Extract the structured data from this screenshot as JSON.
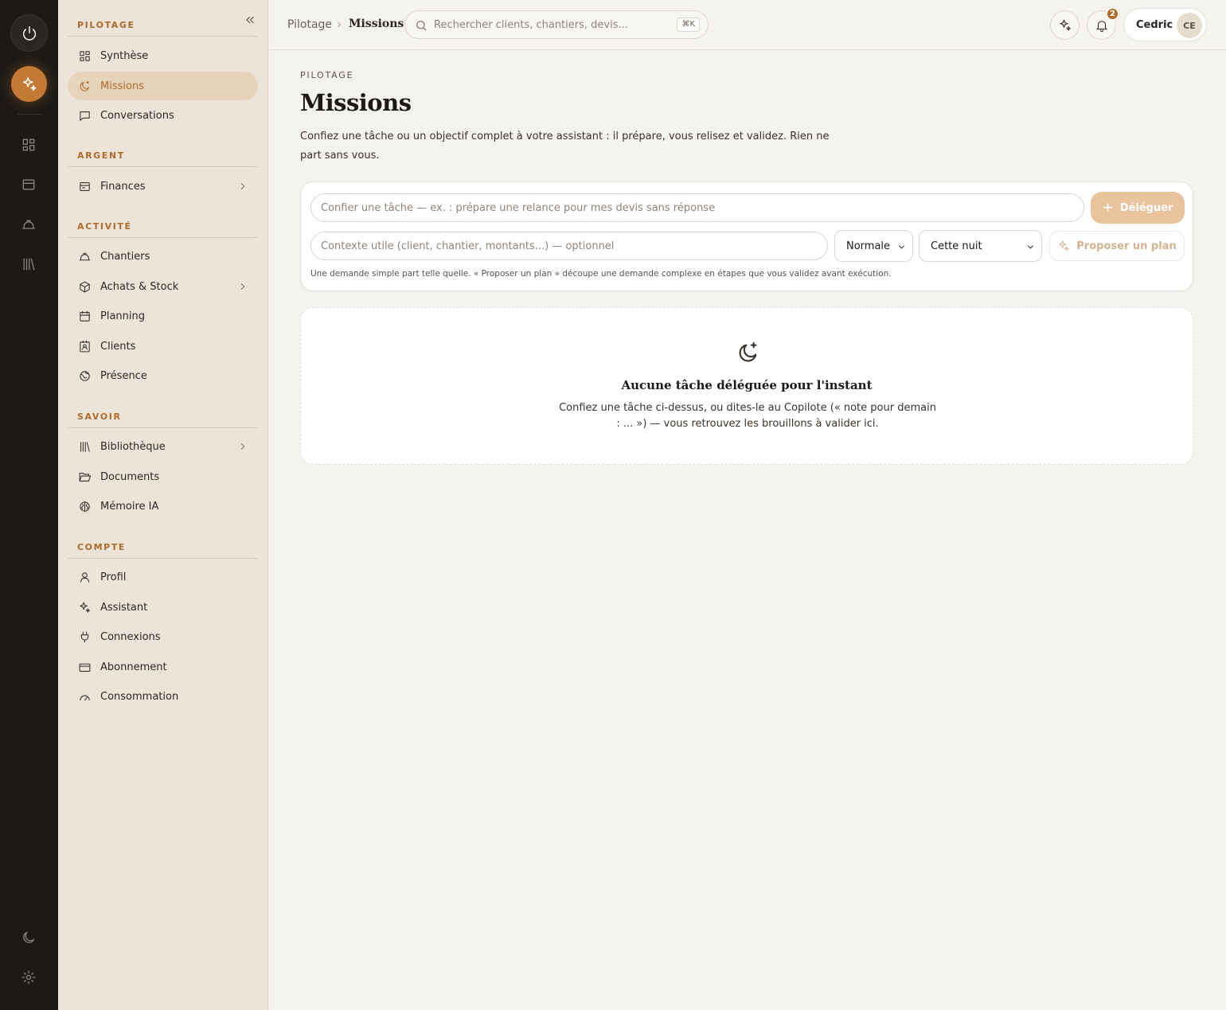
{
  "sidebar": {
    "sections": [
      {
        "title": "PILOTAGE",
        "items": [
          {
            "label": "Synthèse"
          },
          {
            "label": "Missions"
          },
          {
            "label": "Conversations"
          }
        ]
      },
      {
        "title": "ARGENT",
        "items": [
          {
            "label": "Finances"
          }
        ]
      },
      {
        "title": "ACTIVITÉ",
        "items": [
          {
            "label": "Chantiers"
          },
          {
            "label": "Achats & Stock"
          },
          {
            "label": "Planning"
          },
          {
            "label": "Clients"
          },
          {
            "label": "Présence"
          }
        ]
      },
      {
        "title": "SAVOIR",
        "items": [
          {
            "label": "Bibliothèque"
          },
          {
            "label": "Documents"
          },
          {
            "label": "Mémoire IA"
          }
        ]
      },
      {
        "title": "COMPTE",
        "items": [
          {
            "label": "Profil"
          },
          {
            "label": "Assistant"
          },
          {
            "label": "Connexions"
          },
          {
            "label": "Abonnement"
          },
          {
            "label": "Consommation"
          }
        ]
      }
    ]
  },
  "topbar": {
    "breadcrumb": [
      "Pilotage",
      "Missions"
    ],
    "search_placeholder": "Rechercher clients, chantiers, devis...",
    "search_shortcut": "⌘K",
    "notifications_count": "2",
    "user_name": "Cedric",
    "user_initials": "CE"
  },
  "main": {
    "eyebrow": "PILOTAGE",
    "title": "Missions",
    "intro": "Confiez une tâche ou un objectif complet à votre assistant : il prépare, vous relisez et validez. Rien ne part sans vous.",
    "form": {
      "task_placeholder": "Confier une tâche — ex. : prépare une relance pour mes devis sans réponse",
      "delegate_label": "Déléguer",
      "context_placeholder": "Contexte utile (client, chantier, montants...) — optionnel",
      "priority_value": "Normale",
      "when_value": "Cette nuit",
      "plan_label": "Proposer un plan",
      "hint": "Une demande simple part telle quelle. « Proposer un plan » découpe une demande complexe en étapes que vous validez avant exécution."
    },
    "empty": {
      "title": "Aucune tâche déléguée pour l'instant",
      "text": "Confiez une tâche ci-dessus, ou dites-le au Copilote (« note pour demain : ... ») — vous retrouvez les brouillons à valider ici."
    }
  },
  "colors": {
    "accent": "#c47a35",
    "accent_text": "#b06a2a",
    "rail_bg": "#1c1916",
    "sidebar_bg": "#ece4d8",
    "main_bg": "#f5f3ef"
  }
}
